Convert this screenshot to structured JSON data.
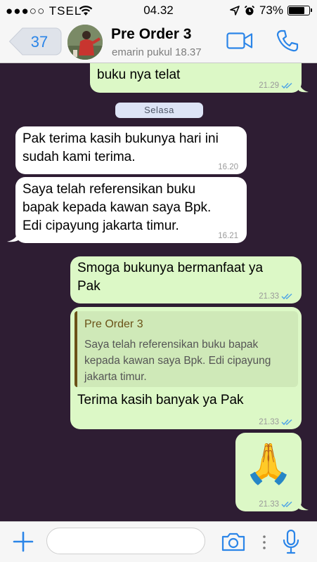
{
  "status_bar": {
    "signal": "●●●○○",
    "carrier": "TSEL",
    "time": "04.32",
    "battery_level": 0.73,
    "battery": "73%"
  },
  "header": {
    "back_count": "37",
    "title": "Pre Order 3",
    "subtitle": "emarin pukul 18.37"
  },
  "day_divider": "Selasa",
  "messages": [
    {
      "dir": "out",
      "text": "buku nya telat",
      "time": "21.29",
      "read": true
    },
    {
      "dir": "in",
      "text": "Pak terima kasih bukunya hari ini sudah kami terima.",
      "time": "16.20"
    },
    {
      "dir": "in",
      "text": "Saya telah referensikan buku bapak kepada kawan saya Bpk. Edi cipayung jakarta timur.",
      "time": "16.21"
    },
    {
      "dir": "out",
      "text": "Smoga bukunya bermanfaat ya Pak",
      "time": "21.33",
      "read": true
    },
    {
      "dir": "out",
      "quote_author": "Pre Order 3",
      "quote_text": "Saya telah referensikan buku bapak kepada kawan saya Bpk. Edi cipayung jakarta timur.",
      "text": "Terima kasih banyak ya Pak",
      "time": "21.33",
      "read": true
    },
    {
      "dir": "out",
      "emoji": "🙏",
      "time": "21.33",
      "read": true
    }
  ],
  "input_bar": {
    "placeholder": ""
  },
  "colors": {
    "accent": "#2b85e8",
    "background": "#2e1d33",
    "outgoing": "#dcf8c6",
    "incoming": "#ffffff",
    "quote_author": "#6b5218"
  },
  "icons": [
    "back-chevron-icon",
    "video-call-icon",
    "phone-call-icon",
    "plus-icon",
    "camera-icon",
    "more-dots-icon",
    "microphone-icon",
    "double-check-icon",
    "wifi-icon",
    "location-arrow-icon",
    "alarm-icon",
    "battery-icon"
  ]
}
